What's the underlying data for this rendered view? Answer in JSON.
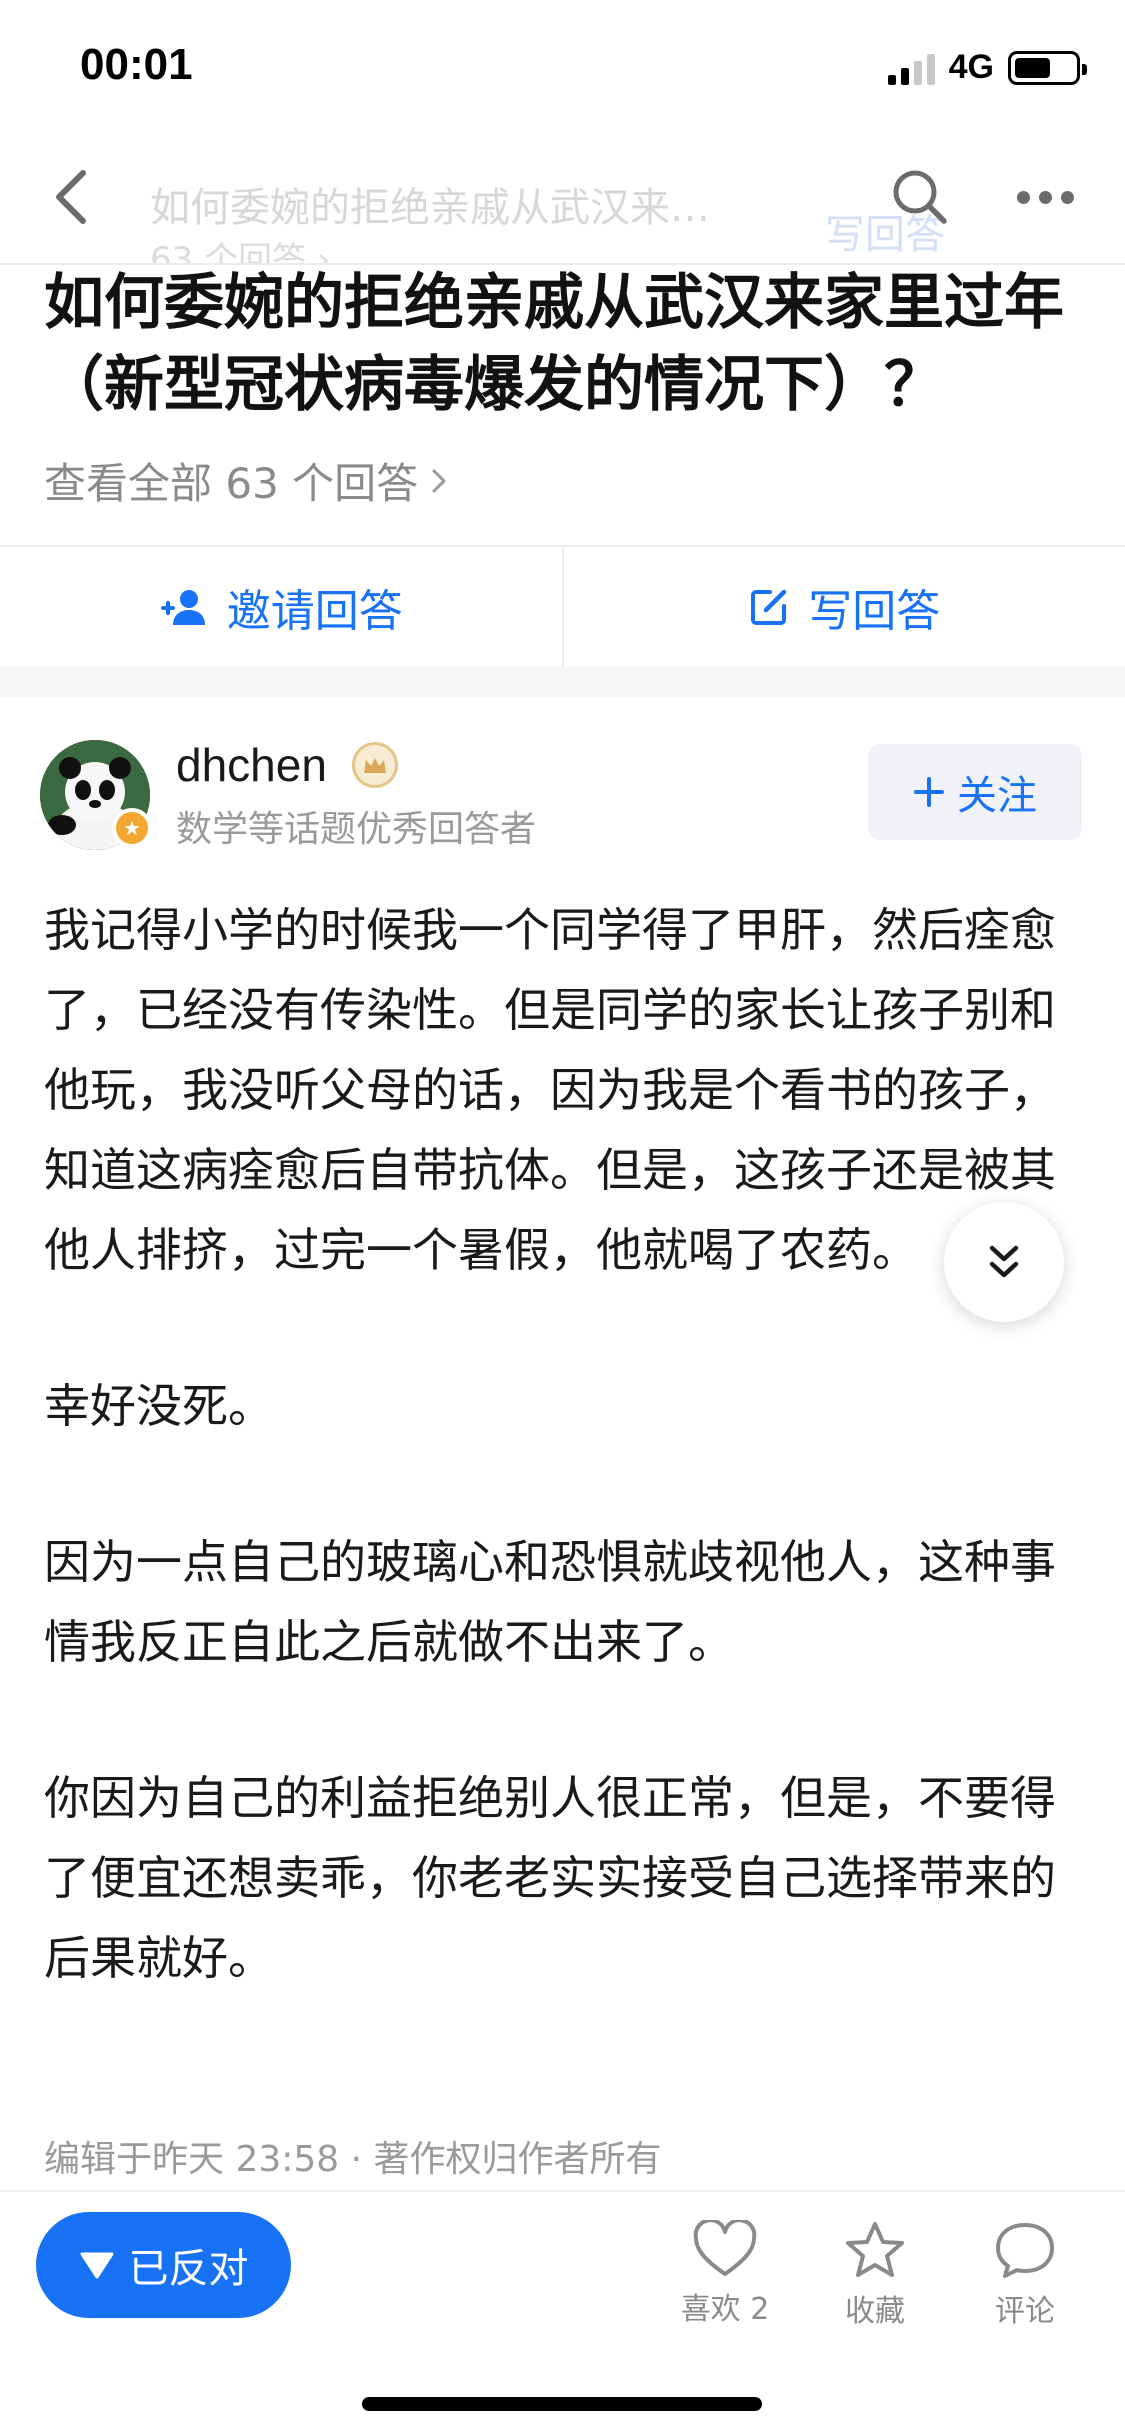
{
  "status_bar": {
    "time": "00:01",
    "network": "4G"
  },
  "nav": {
    "title": "如何委婉的拒绝亲戚从武汉来…",
    "subtitle": "63 个回答 ›",
    "write_hint": "写回答"
  },
  "question": {
    "title": "如何委婉的拒绝亲戚从武汉来家里过年（新型冠状病毒爆发的情况下）？",
    "view_all": "查看全部 63 个回答",
    "invite_label": "邀请回答",
    "write_label": "写回答"
  },
  "author": {
    "name": "dhchen",
    "title": "数学等话题优秀回答者",
    "follow_label": "关注"
  },
  "answer": {
    "paragraphs": [
      "我记得小学的时候我一个同学得了甲肝，然后痊愈了，已经没有传染性。但是同学的家长让孩子别和他玩，我没听父母的话，因为我是个看书的孩子，知道这病痊愈后自带抗体。但是，这孩子还是被其他人排挤，过完一个暑假，他就喝了农药。",
      "幸好没死。",
      "因为一点自己的玻璃心和恐惧就歧视他人，这种事情我反正自此之后就做不出来了。",
      "你因为自己的利益拒绝别人很正常，但是，不要得了便宜还想卖乖，你老老实实接受自己选择带来的后果就好。"
    ],
    "meta": "编辑于昨天 23:58 · 著作权归作者所有"
  },
  "bottom_bar": {
    "oppose_label": "已反对",
    "like_label": "喜欢 2",
    "favorite_label": "收藏",
    "comment_label": "评论"
  },
  "colors": {
    "accent": "#1772f6",
    "secondary_text": "#8a8a8a"
  }
}
